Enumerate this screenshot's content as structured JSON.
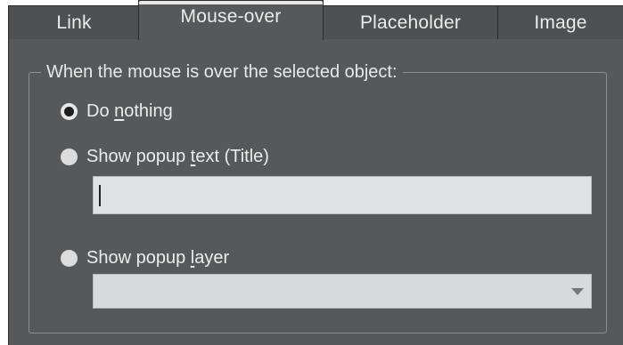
{
  "tabs": [
    {
      "label": "Link",
      "active": false
    },
    {
      "label": "Mouse-over",
      "active": true
    },
    {
      "label": "Placeholder",
      "active": false
    },
    {
      "label": "Image",
      "active": false
    }
  ],
  "group": {
    "legend": "When the mouse is over the selected object:"
  },
  "options": {
    "do_nothing": {
      "pre": "Do ",
      "accel": "n",
      "post": "othing",
      "selected": true
    },
    "show_popup_text": {
      "pre": "Show popup ",
      "accel": "t",
      "post": "ext (Title)",
      "selected": false
    },
    "show_popup_layer": {
      "pre": "Show popup ",
      "accel": "l",
      "post": "ayer",
      "selected": false
    }
  },
  "popup_text_field": {
    "value": ""
  },
  "popup_layer_select": {
    "selected": ""
  },
  "icons": {
    "dropdown": "chevron-down-icon"
  }
}
